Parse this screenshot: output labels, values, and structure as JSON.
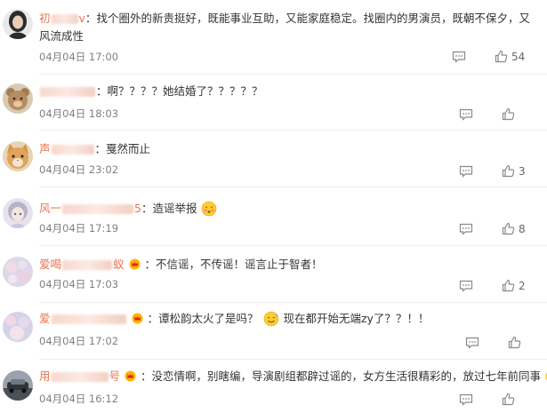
{
  "comments": [
    {
      "username_visible_prefix": "初",
      "username_visible_suffix": "v",
      "text": "找个圈外的新贵挺好，既能事业互助，又能家庭稳定。找圈内的男演员，既朝不保夕，又风流成性",
      "time": "04月04日 17:00",
      "likes": "54"
    },
    {
      "username_visible_prefix": "",
      "username_visible_suffix": "",
      "text": "啊？？？？她结婚了？？？？？",
      "time": "04月04日 18:03",
      "likes": ""
    },
    {
      "username_visible_prefix": "声",
      "username_visible_suffix": "",
      "text": "戛然而止",
      "time": "04月04日 23:02",
      "likes": "3"
    },
    {
      "username_visible_prefix": "风一",
      "username_visible_suffix": "5",
      "text": "造谣举报",
      "time": "04月04日 17:19",
      "likes": "8"
    },
    {
      "username_visible_prefix": "爱喝",
      "username_visible_suffix": "蚁",
      "text": "不信谣，不传谣！谣言止于智者！",
      "time": "04月04日 17:03",
      "likes": "2"
    },
    {
      "username_visible_prefix": "爱",
      "username_visible_suffix": "",
      "text_part1": "谭松韵太火了是吗？",
      "text_part2": "现在都开始无端zy了？？！！",
      "time": "04月04日 17:02",
      "likes": ""
    },
    {
      "username_visible_prefix": "用",
      "username_visible_suffix": "号",
      "text": "没恋情啊，别瞎编，导演剧组都辟过谣的，女方生活很精彩的，放过七年前同事",
      "time": "04月04日 16:12",
      "likes": ""
    }
  ],
  "icons": {
    "comment": "comment-icon",
    "like": "thumbs-up-icon",
    "badge": "member-crown-badge-icon",
    "emoji_blush": "emoji-blushing-icon",
    "emoji_sweat": "emoji-sweat-smile-icon"
  },
  "colors": {
    "username": "#eb7350",
    "text": "#333333",
    "time": "#808080",
    "icon": "#8a8a8a",
    "separator": "#f0f0f0"
  }
}
